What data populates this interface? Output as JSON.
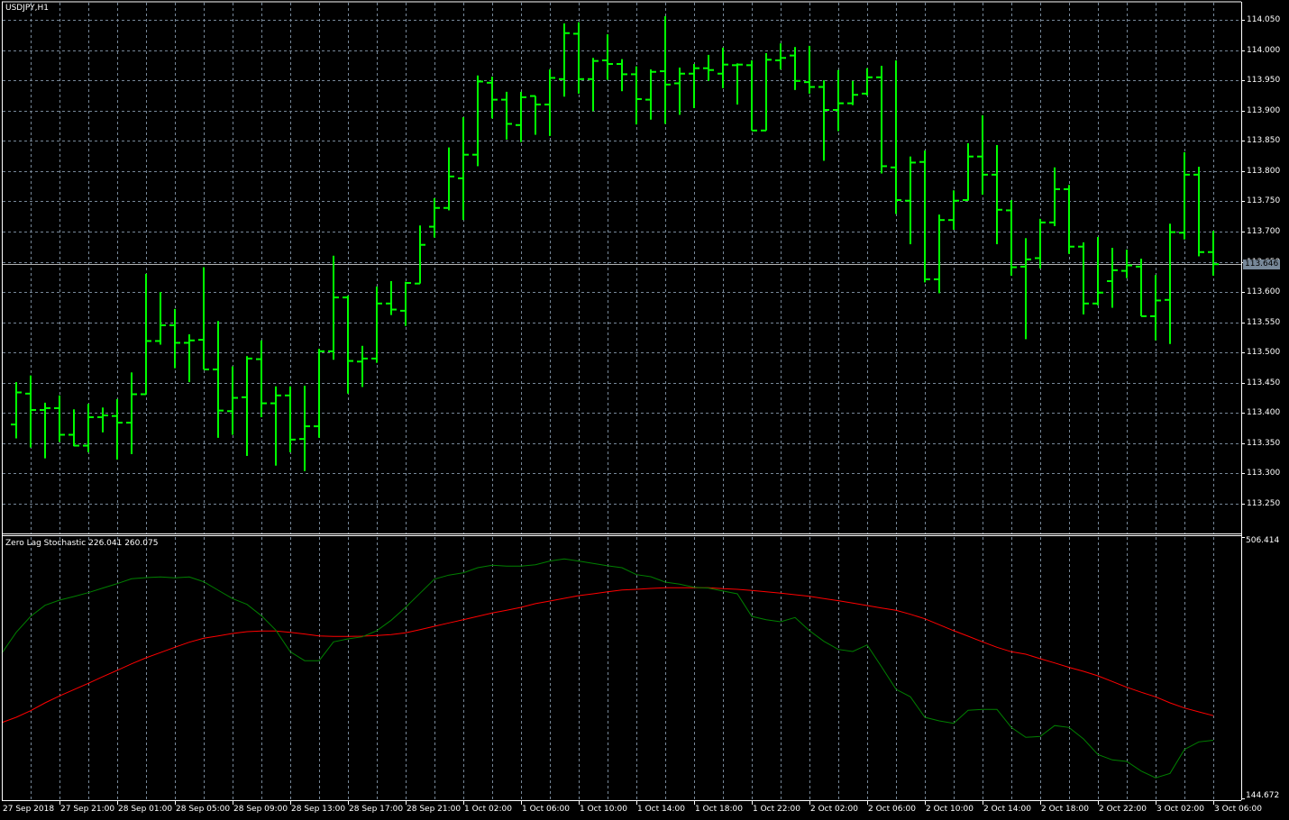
{
  "window": {
    "title": "USDJPY,H1",
    "symbol": "USDJPY",
    "timeframe": "H1"
  },
  "colors": {
    "background": "#000000",
    "grid": "#778899",
    "bars": "#00ff00",
    "stoch_main": "#008000",
    "stoch_signal": "#ff0000",
    "border": "#ffffff",
    "price_line": "#b0b0b0"
  },
  "price_axis": {
    "labels": [
      "114.050",
      "114.000",
      "113.950",
      "113.900",
      "113.850",
      "113.800",
      "113.750",
      "113.700",
      "113.650",
      "113.600",
      "113.550",
      "113.500",
      "113.450",
      "113.400",
      "113.350",
      "113.300",
      "113.250"
    ],
    "max": 114.05,
    "min": 113.25,
    "step": 0.05,
    "current_price": 113.646,
    "current_price_label": "113.646"
  },
  "indicator": {
    "title": "Zero Lag Stochastic 226.041 260.075",
    "max_label": "506.414",
    "min_label": "144.672",
    "max": 506.414,
    "min": 144.672,
    "main": [
      346.1,
      375.0,
      397.0,
      412.3,
      419.4,
      424.4,
      429.7,
      436.0,
      442.2,
      448.9,
      450.5,
      451.4,
      450.1,
      451.4,
      444.7,
      433.1,
      421.5,
      413.6,
      397.9,
      378.0,
      348.2,
      335.8,
      335.8,
      361.9,
      366.0,
      368.8,
      377.2,
      391.7,
      409.5,
      429.0,
      448.4,
      453.9,
      457.1,
      464.2,
      467.5,
      466.3,
      466.3,
      468.3,
      473.3,
      476.2,
      473.3,
      470.0,
      466.7,
      464.2,
      454.6,
      451.7,
      444.3,
      441.4,
      437.2,
      436.0,
      431.9,
      428.1,
      397.0,
      392.4,
      389.6,
      395.4,
      377.2,
      362.6,
      351.4,
      348.6,
      357.6,
      327.4,
      296.4,
      286.0,
      257.8,
      252.8,
      249.5,
      267.4,
      268.6,
      268.6,
      243.8,
      230.1,
      231.3,
      246.3,
      243.8,
      228.0,
      206.5,
      199.0,
      196.9,
      183.6,
      174.2,
      180.4,
      213.4,
      223.9,
      226.041
    ],
    "signal": [
      250.4,
      257.8,
      266.9,
      277.7,
      287.3,
      296.0,
      304.7,
      313.8,
      322.5,
      331.5,
      339.9,
      347.0,
      354.4,
      361.4,
      366.8,
      370.1,
      373.4,
      375.9,
      376.8,
      376.8,
      375.0,
      372.6,
      370.1,
      369.3,
      369.3,
      369.7,
      370.6,
      371.8,
      374.3,
      378.8,
      383.4,
      388.0,
      392.4,
      397.0,
      401.6,
      405.4,
      409.5,
      414.5,
      418.2,
      421.9,
      425.6,
      428.1,
      431.0,
      433.5,
      434.3,
      435.6,
      436.5,
      436.5,
      436.5,
      436.5,
      435.2,
      434.3,
      432.7,
      431.0,
      429.0,
      426.9,
      424.8,
      421.5,
      418.6,
      415.3,
      412.0,
      408.6,
      405.4,
      399.9,
      393.7,
      385.5,
      377.2,
      369.7,
      361.9,
      354.4,
      348.2,
      344.8,
      338.6,
      332.8,
      326.6,
      321.2,
      315.0,
      307.2,
      299.2,
      292.3,
      286.0,
      277.7,
      270.6,
      265.3,
      260.075
    ]
  },
  "time_axis": {
    "labels": [
      "27 Sep 2018",
      "27 Sep 21:00",
      "28 Sep 01:00",
      "28 Sep 05:00",
      "28 Sep 09:00",
      "28 Sep 13:00",
      "28 Sep 17:00",
      "28 Sep 21:00",
      "1 Oct 02:00",
      "1 Oct 06:00",
      "1 Oct 10:00",
      "1 Oct 14:00",
      "1 Oct 18:00",
      "1 Oct 22:00",
      "2 Oct 02:00",
      "2 Oct 06:00",
      "2 Oct 10:00",
      "2 Oct 14:00",
      "2 Oct 18:00",
      "2 Oct 22:00",
      "3 Oct 02:00",
      "3 Oct 06:00"
    ]
  },
  "chart_data": {
    "type": "ohlc",
    "title": "USDJPY,H1",
    "ylim": [
      113.25,
      114.05
    ],
    "bars_ohlc": [
      [
        113.381,
        113.451,
        113.358,
        113.434
      ],
      [
        113.432,
        113.462,
        113.343,
        113.405
      ],
      [
        113.405,
        113.417,
        113.325,
        113.408
      ],
      [
        113.408,
        113.429,
        113.352,
        113.364
      ],
      [
        113.364,
        113.406,
        113.345,
        113.346
      ],
      [
        113.346,
        113.415,
        113.335,
        113.393
      ],
      [
        113.393,
        113.409,
        113.368,
        113.396
      ],
      [
        113.395,
        113.423,
        113.323,
        113.384
      ],
      [
        113.384,
        113.467,
        113.332,
        113.431
      ],
      [
        113.431,
        113.63,
        113.431,
        113.519
      ],
      [
        113.519,
        113.6,
        113.513,
        113.545
      ],
      [
        113.545,
        113.572,
        113.474,
        113.516
      ],
      [
        113.516,
        113.53,
        113.451,
        113.52
      ],
      [
        113.521,
        113.641,
        113.472,
        113.472
      ],
      [
        113.472,
        113.552,
        113.359,
        113.404
      ],
      [
        113.403,
        113.477,
        113.364,
        113.425
      ],
      [
        113.426,
        113.494,
        113.329,
        113.49
      ],
      [
        113.489,
        113.52,
        113.393,
        113.416
      ],
      [
        113.416,
        113.444,
        113.313,
        113.429
      ],
      [
        113.429,
        113.444,
        113.335,
        113.356
      ],
      [
        113.357,
        113.445,
        113.304,
        113.378
      ],
      [
        113.378,
        113.506,
        113.359,
        113.502
      ],
      [
        113.502,
        113.66,
        113.488,
        113.591
      ],
      [
        113.591,
        113.594,
        113.432,
        113.486
      ],
      [
        113.485,
        113.511,
        113.443,
        113.49
      ],
      [
        113.49,
        113.609,
        113.483,
        113.581
      ],
      [
        113.581,
        113.618,
        113.562,
        113.571
      ],
      [
        113.569,
        113.617,
        113.544,
        113.615
      ],
      [
        113.614,
        113.71,
        113.614,
        113.678
      ],
      [
        113.708,
        113.755,
        113.69,
        113.739
      ],
      [
        113.739,
        113.839,
        113.735,
        113.791
      ],
      [
        113.788,
        113.889,
        113.719,
        113.827
      ],
      [
        113.827,
        113.958,
        113.808,
        113.948
      ],
      [
        113.946,
        113.956,
        113.887,
        113.918
      ],
      [
        113.918,
        113.931,
        113.852,
        113.878
      ],
      [
        113.876,
        113.931,
        113.848,
        113.922
      ],
      [
        113.924,
        113.924,
        113.86,
        113.91
      ],
      [
        113.91,
        113.968,
        113.858,
        113.954
      ],
      [
        113.952,
        114.044,
        113.923,
        114.028
      ],
      [
        114.027,
        114.046,
        113.928,
        113.952
      ],
      [
        113.952,
        113.987,
        113.899,
        113.982
      ],
      [
        113.983,
        114.026,
        113.951,
        113.977
      ],
      [
        113.977,
        113.985,
        113.932,
        113.96
      ],
      [
        113.96,
        113.973,
        113.877,
        113.919
      ],
      [
        113.918,
        113.968,
        113.885,
        113.964
      ],
      [
        113.965,
        114.056,
        113.878,
        113.943
      ],
      [
        113.945,
        113.971,
        113.893,
        113.961
      ],
      [
        113.961,
        113.977,
        113.904,
        113.97
      ],
      [
        113.97,
        113.992,
        113.949,
        113.967
      ],
      [
        113.961,
        114.004,
        113.937,
        113.976
      ],
      [
        113.975,
        113.978,
        113.91,
        113.976
      ],
      [
        113.975,
        113.983,
        113.867,
        113.867
      ],
      [
        113.867,
        113.995,
        113.867,
        113.984
      ],
      [
        113.983,
        114.011,
        113.968,
        113.987
      ],
      [
        113.991,
        114.005,
        113.934,
        113.949
      ],
      [
        113.947,
        114.007,
        113.928,
        113.939
      ],
      [
        113.939,
        113.95,
        113.817,
        113.901
      ],
      [
        113.901,
        113.967,
        113.866,
        113.912
      ],
      [
        113.912,
        113.949,
        113.909,
        113.926
      ],
      [
        113.928,
        113.97,
        113.925,
        113.955
      ],
      [
        113.955,
        113.974,
        113.796,
        113.808
      ],
      [
        113.806,
        113.983,
        113.729,
        113.752
      ],
      [
        113.751,
        113.824,
        113.679,
        113.814
      ],
      [
        113.815,
        113.834,
        113.616,
        113.621
      ],
      [
        113.621,
        113.728,
        113.598,
        113.719
      ],
      [
        113.719,
        113.768,
        113.703,
        113.751
      ],
      [
        113.752,
        113.846,
        113.751,
        113.824
      ],
      [
        113.824,
        113.892,
        113.761,
        113.794
      ],
      [
        113.794,
        113.843,
        113.679,
        113.736
      ],
      [
        113.735,
        113.752,
        113.627,
        113.641
      ],
      [
        113.642,
        113.689,
        113.522,
        113.654
      ],
      [
        113.656,
        113.721,
        113.639,
        113.715
      ],
      [
        113.715,
        113.806,
        113.709,
        113.77
      ],
      [
        113.77,
        113.777,
        113.663,
        113.675
      ],
      [
        113.675,
        113.682,
        113.563,
        113.581
      ],
      [
        113.581,
        113.691,
        113.578,
        113.599
      ],
      [
        113.618,
        113.673,
        113.574,
        113.636
      ],
      [
        113.635,
        113.67,
        113.623,
        113.644
      ],
      [
        113.642,
        113.655,
        113.56,
        113.56
      ],
      [
        113.56,
        113.628,
        113.52,
        113.586
      ],
      [
        113.587,
        113.713,
        113.514,
        113.699
      ],
      [
        113.698,
        113.831,
        113.687,
        113.794
      ],
      [
        113.794,
        113.807,
        113.659,
        113.666
      ],
      [
        113.666,
        113.701,
        113.627,
        113.646
      ]
    ]
  }
}
